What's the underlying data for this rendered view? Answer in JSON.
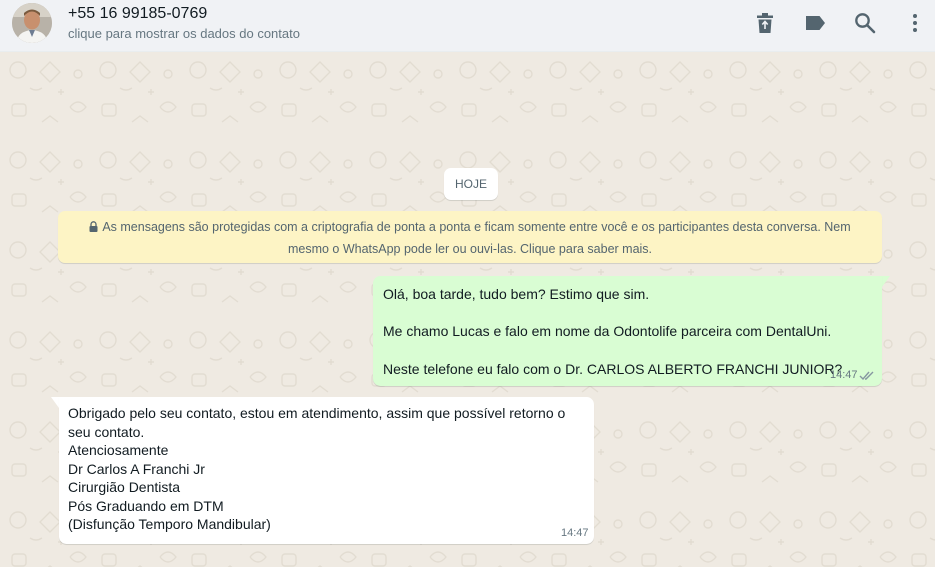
{
  "header": {
    "contact_name": "+55 16 99185-0769",
    "contact_subtitle": "clique para mostrar os dados do contato",
    "actions": [
      "trash-icon",
      "label-icon",
      "search-icon",
      "menu-icon"
    ]
  },
  "chat": {
    "day_label": "HOJE",
    "encryption_notice": "As mensagens são protegidas com a criptografia de ponta a ponta e ficam somente entre você e os participantes desta conversa. Nem mesmo o WhatsApp pode ler ou ouvi-las. Clique para saber mais.",
    "outgoing": {
      "lines": [
        "Olá, boa tarde, tudo bem? Estimo que sim.",
        "Me chamo Lucas e falo em nome da Odontolife parceira com DentalUni.",
        "Neste telefone eu falo com o Dr. CARLOS ALBERTO FRANCHI JUNIOR?"
      ],
      "time": "14:47",
      "status": "read"
    },
    "incoming": {
      "lines": [
        "Obrigado pelo seu contato, estou em  atendimento, assim que possível retorno o",
        "seu contato.",
        "Atenciosamente",
        "Dr Carlos A Franchi Jr",
        "Cirurgião Dentista",
        "Pós Graduando em DTM",
        "(Disfunção Temporo Mandibular)"
      ],
      "time": "14:47"
    }
  },
  "colors": {
    "header_bg": "#f0f2f5",
    "chat_bg": "#efeae2",
    "outgoing_bubble": "#d9fdd3",
    "incoming_bubble": "#ffffff",
    "notice_bg": "#fdf4c5",
    "read_ticks": "#53bdeb"
  }
}
